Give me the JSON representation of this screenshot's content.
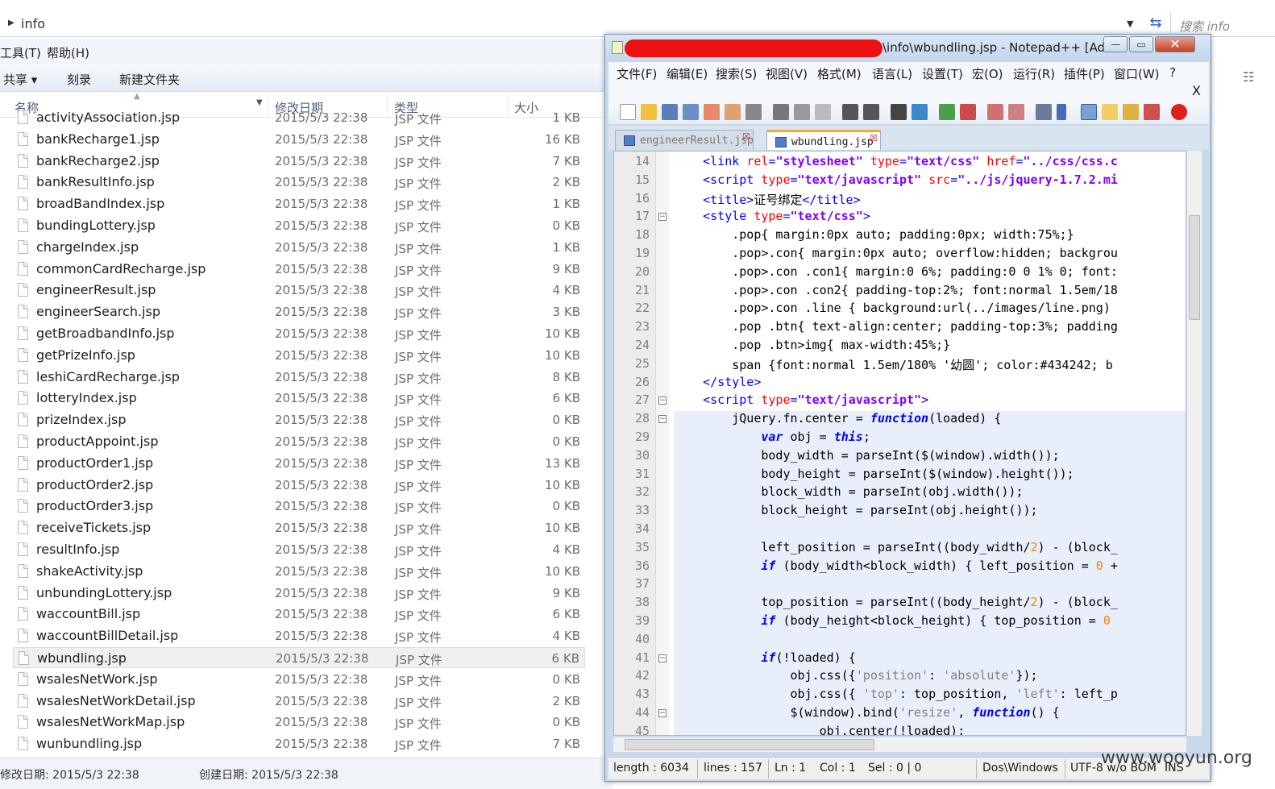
{
  "explorer": {
    "address_path": "info",
    "search_placeholder": "搜索 info",
    "menu": [
      "工具(T)",
      "帮助(H)"
    ],
    "toolbar": [
      "共享 ▾",
      "刻录",
      "新建文件夹"
    ],
    "columns": [
      "名称",
      "修改日期",
      "类型",
      "大小"
    ],
    "files": [
      {
        "name": "activityAssociation.jsp",
        "date": "2015/5/3 22:38",
        "type": "JSP 文件",
        "size": "1 KB"
      },
      {
        "name": "bankRecharge1.jsp",
        "date": "2015/5/3 22:38",
        "type": "JSP 文件",
        "size": "16 KB"
      },
      {
        "name": "bankRecharge2.jsp",
        "date": "2015/5/3 22:38",
        "type": "JSP 文件",
        "size": "7 KB"
      },
      {
        "name": "bankResultInfo.jsp",
        "date": "2015/5/3 22:38",
        "type": "JSP 文件",
        "size": "2 KB"
      },
      {
        "name": "broadBandIndex.jsp",
        "date": "2015/5/3 22:38",
        "type": "JSP 文件",
        "size": "1 KB"
      },
      {
        "name": "bundingLottery.jsp",
        "date": "2015/5/3 22:38",
        "type": "JSP 文件",
        "size": "0 KB"
      },
      {
        "name": "chargeIndex.jsp",
        "date": "2015/5/3 22:38",
        "type": "JSP 文件",
        "size": "1 KB"
      },
      {
        "name": "commonCardRecharge.jsp",
        "date": "2015/5/3 22:38",
        "type": "JSP 文件",
        "size": "9 KB"
      },
      {
        "name": "engineerResult.jsp",
        "date": "2015/5/3 22:38",
        "type": "JSP 文件",
        "size": "4 KB"
      },
      {
        "name": "engineerSearch.jsp",
        "date": "2015/5/3 22:38",
        "type": "JSP 文件",
        "size": "3 KB"
      },
      {
        "name": "getBroadbandInfo.jsp",
        "date": "2015/5/3 22:38",
        "type": "JSP 文件",
        "size": "10 KB"
      },
      {
        "name": "getPrizeInfo.jsp",
        "date": "2015/5/3 22:38",
        "type": "JSP 文件",
        "size": "10 KB"
      },
      {
        "name": "leshiCardRecharge.jsp",
        "date": "2015/5/3 22:38",
        "type": "JSP 文件",
        "size": "8 KB"
      },
      {
        "name": "lotteryIndex.jsp",
        "date": "2015/5/3 22:38",
        "type": "JSP 文件",
        "size": "6 KB"
      },
      {
        "name": "prizeIndex.jsp",
        "date": "2015/5/3 22:38",
        "type": "JSP 文件",
        "size": "0 KB"
      },
      {
        "name": "productAppoint.jsp",
        "date": "2015/5/3 22:38",
        "type": "JSP 文件",
        "size": "0 KB"
      },
      {
        "name": "productOrder1.jsp",
        "date": "2015/5/3 22:38",
        "type": "JSP 文件",
        "size": "13 KB"
      },
      {
        "name": "productOrder2.jsp",
        "date": "2015/5/3 22:38",
        "type": "JSP 文件",
        "size": "10 KB"
      },
      {
        "name": "productOrder3.jsp",
        "date": "2015/5/3 22:38",
        "type": "JSP 文件",
        "size": "0 KB"
      },
      {
        "name": "receiveTickets.jsp",
        "date": "2015/5/3 22:38",
        "type": "JSP 文件",
        "size": "10 KB"
      },
      {
        "name": "resultInfo.jsp",
        "date": "2015/5/3 22:38",
        "type": "JSP 文件",
        "size": "4 KB"
      },
      {
        "name": "shakeActivity.jsp",
        "date": "2015/5/3 22:38",
        "type": "JSP 文件",
        "size": "10 KB"
      },
      {
        "name": "unbundingLottery.jsp",
        "date": "2015/5/3 22:38",
        "type": "JSP 文件",
        "size": "9 KB"
      },
      {
        "name": "waccountBill.jsp",
        "date": "2015/5/3 22:38",
        "type": "JSP 文件",
        "size": "6 KB"
      },
      {
        "name": "waccountBillDetail.jsp",
        "date": "2015/5/3 22:38",
        "type": "JSP 文件",
        "size": "4 KB"
      },
      {
        "name": "wbundling.jsp",
        "date": "2015/5/3 22:38",
        "type": "JSP 文件",
        "size": "6 KB",
        "selected": true
      },
      {
        "name": "wsalesNetWork.jsp",
        "date": "2015/5/3 22:38",
        "type": "JSP 文件",
        "size": "0 KB"
      },
      {
        "name": "wsalesNetWorkDetail.jsp",
        "date": "2015/5/3 22:38",
        "type": "JSP 文件",
        "size": "2 KB"
      },
      {
        "name": "wsalesNetWorkMap.jsp",
        "date": "2015/5/3 22:38",
        "type": "JSP 文件",
        "size": "0 KB"
      },
      {
        "name": "wunbundling.jsp",
        "date": "2015/5/3 22:38",
        "type": "JSP 文件",
        "size": "7 KB"
      }
    ],
    "status_modified": "修改日期: 2015/5/3 22:38",
    "status_created": "创建日期: 2015/5/3 22:38"
  },
  "npp": {
    "title": "\\info\\wbundling.jsp - Notepad++ [Ad...",
    "menu": [
      "文件(F)",
      "编辑(E)",
      "搜索(S)",
      "视图(V)",
      "格式(M)",
      "语言(L)",
      "设置(T)",
      "宏(O)",
      "运行(R)",
      "插件(P)",
      "窗口(W)",
      "?"
    ],
    "menu_close": "X",
    "tabs": [
      "engineerResult.jsp",
      "wbundling.jsp"
    ],
    "status": {
      "length": "length : 6034",
      "lines": "lines : 157",
      "ln": "Ln : 1",
      "col": "Col : 1",
      "sel": "Sel : 0 | 0",
      "eol": "Dos\\Windows",
      "encoding": "UTF-8 w/o BOM",
      "mode": "INS"
    }
  },
  "code": [
    {
      "n": "14",
      "html": "    <span class='tag'>&lt;link</span> <span class='attr'>rel</span><span class='tag'>=</span><span class='str'>\"stylesheet\"</span> <span class='attr'>type</span><span class='tag'>=</span><span class='str'>\"text/css\"</span> <span class='attr'>href</span><span class='tag'>=</span><span class='str'>\"../css/css.c</span>"
    },
    {
      "n": "15",
      "html": "    <span class='tag'>&lt;script</span> <span class='attr'>type</span><span class='tag'>=</span><span class='str'>\"text/javascript\"</span> <span class='attr'>src</span><span class='tag'>=</span><span class='str'>\"../js/jquery-1.7.2.mi</span>"
    },
    {
      "n": "16",
      "html": "    <span class='tag'>&lt;title&gt;</span>证号绑定<span class='tag'>&lt;/title&gt;</span>"
    },
    {
      "n": "17",
      "html": "    <span class='tag'>&lt;style</span> <span class='attr'>type</span><span class='tag'>=</span><span class='str'>\"text/css\"</span><span class='tag'>&gt;</span>",
      "fold": "−"
    },
    {
      "n": "18",
      "html": "        .pop{ margin:0px auto; padding:0px; width:75%;}"
    },
    {
      "n": "19",
      "html": "        .pop&gt;.con{ margin:0px auto; overflow:hidden; backgrou"
    },
    {
      "n": "20",
      "html": "        .pop&gt;.con .con1{ margin:0 6%; padding:0 0 1% 0; font:"
    },
    {
      "n": "21",
      "html": "        .pop&gt;.con .con2{ padding-top:2%; font:normal 1.5em/18"
    },
    {
      "n": "22",
      "html": "        .pop&gt;.con .line { background:url(../images/line.png)"
    },
    {
      "n": "23",
      "html": "        .pop .btn{ text-align:center; padding-top:3%; padding"
    },
    {
      "n": "24",
      "html": "        .pop .btn&gt;img{ max-width:45%;}"
    },
    {
      "n": "25",
      "html": "        span {font:normal 1.5em/180% '幼圆'; color:#434242; b"
    },
    {
      "n": "26",
      "html": "    <span class='tag'>&lt;/style&gt;</span>"
    },
    {
      "n": "27",
      "html": "    <span class='tag'>&lt;script</span> <span class='attr'>type</span><span class='tag'>=</span><span class='str'>\"text/javascript\"</span><span class='tag'>&gt;</span>",
      "fold": "−"
    },
    {
      "n": "28",
      "html": "        jQuery.fn.center = <span class='kw'>function</span>(loaded) {",
      "fold": "−",
      "hl": true
    },
    {
      "n": "29",
      "html": "            <span class='kw'>var</span> obj = <span class='kw'>this</span>;",
      "hl": true
    },
    {
      "n": "30",
      "html": "            body_width = parseInt($(window).width());",
      "hl": true
    },
    {
      "n": "31",
      "html": "            body_height = parseInt($(window).height());",
      "hl": true
    },
    {
      "n": "32",
      "html": "            block_width = parseInt(obj.width());",
      "hl": true
    },
    {
      "n": "33",
      "html": "            block_height = parseInt(obj.height());",
      "hl": true
    },
    {
      "n": "34",
      "html": "",
      "hl": true
    },
    {
      "n": "35",
      "html": "            left_position = parseInt((body_width/<span class='num'>2</span>) - (block_",
      "hl": true
    },
    {
      "n": "36",
      "html": "            <span class='kw'>if</span> (body_width&lt;block_width) { left_position = <span class='num'>0</span> +",
      "hl": true
    },
    {
      "n": "37",
      "html": "",
      "hl": true
    },
    {
      "n": "38",
      "html": "            top_position = parseInt((body_height/<span class='num'>2</span>) - (block_",
      "hl": true
    },
    {
      "n": "39",
      "html": "            <span class='kw'>if</span> (body_height&lt;block_height) { top_position = <span class='num'>0</span>",
      "hl": true
    },
    {
      "n": "40",
      "html": "",
      "hl": true
    },
    {
      "n": "41",
      "html": "            <span class='kw'>if</span>(!loaded) {",
      "fold": "−",
      "hl": true
    },
    {
      "n": "42",
      "html": "                obj.css({<span class='sq'>'position'</span>: <span class='sq'>'absolute'</span>});",
      "hl": true
    },
    {
      "n": "43",
      "html": "                obj.css({ <span class='sq'>'top'</span>: top_position, <span class='sq'>'left'</span>: left_p",
      "hl": true
    },
    {
      "n": "44",
      "html": "                $(window).bind(<span class='sq'>'resize'</span>, <span class='kw'>function</span>() {",
      "fold": "−",
      "hl": true
    },
    {
      "n": "45",
      "html": "                    obj.center(!loaded);",
      "hl": true
    }
  ],
  "watermark": "www.wooyun.org"
}
